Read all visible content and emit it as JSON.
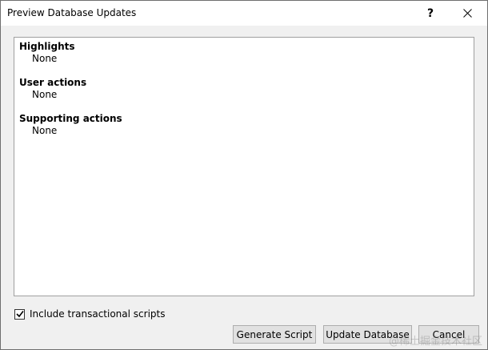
{
  "window": {
    "title": "Preview Database Updates",
    "help_label": "?"
  },
  "sections": [
    {
      "title": "Highlights",
      "value": "None"
    },
    {
      "title": "User actions",
      "value": "None"
    },
    {
      "title": "Supporting actions",
      "value": "None"
    }
  ],
  "options": {
    "include_transactional_label": "Include transactional scripts",
    "include_transactional_checked": true
  },
  "buttons": {
    "generate_label": "Generate Script",
    "update_label": "Update Database",
    "cancel_label": "Cancel"
  },
  "watermark": "@稀土掘金技术社区"
}
